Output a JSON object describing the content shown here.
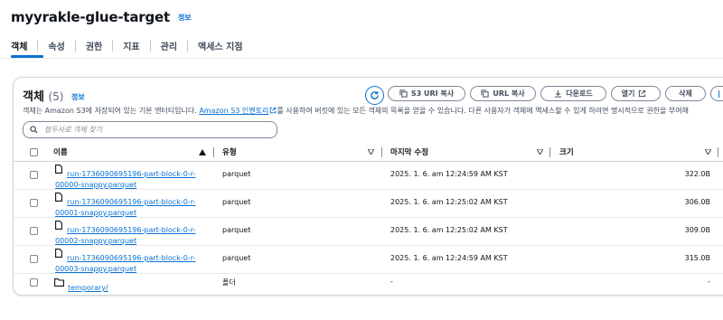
{
  "page": {
    "title": "myyrakle-glue-target",
    "info_label": "정보"
  },
  "tabs": [
    "객체",
    "속성",
    "권한",
    "지표",
    "관리",
    "액세스 지점"
  ],
  "objects": {
    "title": "객체",
    "count": "(5)",
    "info_label": "정보",
    "buttons": {
      "copy_s3_uri": "S3 URI 복사",
      "copy_url": "URL 복사",
      "download": "다운로드",
      "open": "열기",
      "delete": "삭제"
    },
    "description_prefix": "객체는 Amazon S3에 저장되어 있는 기본 엔터티입니다.",
    "description_link": "Amazon S3 인벤토리",
    "description_suffix": "를 사용하여 버킷에 있는 모든 객체의 목록을 얻을 수 있습니다. 다른 사용자가 객체에 액세스할 수 있게 하려면 명시적으로 권한을 부여해",
    "search_placeholder": "접두사로 객체 찾기",
    "columns": {
      "name": "이름",
      "type": "유형",
      "modified": "마지막 수정",
      "size": "크기"
    },
    "rows": [
      {
        "name_line1": "run-1736090695196-part-block-0-r-",
        "name_line2": "00000-snappy.parquet",
        "type": "parquet",
        "modified": "2025. 1. 6. am 12:24:59 AM KST",
        "size": "322.0B"
      },
      {
        "name_line1": "run-1736090695196-part-block-0-r-",
        "name_line2": "00001-snappy.parquet",
        "type": "parquet",
        "modified": "2025. 1. 6. am 12:25:02 AM KST",
        "size": "306.0B"
      },
      {
        "name_line1": "run-1736090695196-part-block-0-r-",
        "name_line2": "00002-snappy.parquet",
        "type": "parquet",
        "modified": "2025. 1. 6. am 12:25:02 AM KST",
        "size": "309.0B"
      },
      {
        "name_line1": "run-1736090695196-part-block-0-r-",
        "name_line2": "00003-snappy.parquet",
        "type": "parquet",
        "modified": "2025. 1. 6. am 12:24:59 AM KST",
        "size": "315.0B"
      },
      {
        "name_line1": "temporary/",
        "name_line2": "",
        "type": "폴더",
        "modified": "-",
        "size": "-"
      }
    ]
  },
  "colors": {
    "accent": "#0972d3",
    "text": "#0f141a",
    "muted": "#414d5c",
    "border": "#7d8998"
  }
}
